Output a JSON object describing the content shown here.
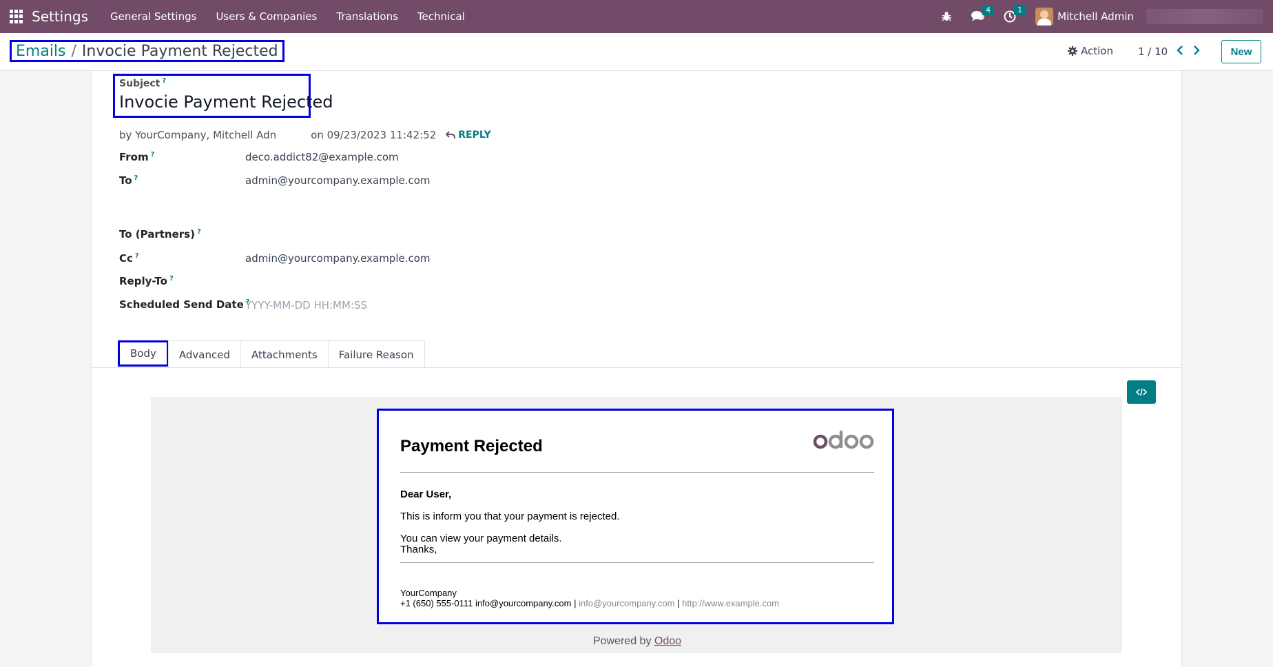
{
  "navbar": {
    "app_title": "Settings",
    "menu": [
      "General Settings",
      "Users & Companies",
      "Translations",
      "Technical"
    ],
    "messages_count": "4",
    "activities_count": "1",
    "user_name": "Mitchell Admin"
  },
  "control": {
    "breadcrumb_parent": "Emails",
    "breadcrumb_separator": "/",
    "breadcrumb_current": "Invocie Payment Rejected",
    "action_label": "Action",
    "pager": "1 / 10",
    "new_label": "New"
  },
  "form": {
    "subject_label": "Subject",
    "subject_value": "Invocie Payment Rejected",
    "help_mark": "?",
    "author": "by YourCompany, Mitchell Adn",
    "date": "on 09/23/2023 11:42:52",
    "reply_label": "REPLY",
    "fields": {
      "from_label": "From",
      "from_value": "deco.addict82@example.com",
      "to_label": "To",
      "to_value": "admin@yourcompany.example.com",
      "partners_label": "To (Partners)",
      "cc_label": "Cc",
      "cc_value": "admin@yourcompany.example.com",
      "reply_to_label": "Reply-To",
      "scheduled_label": "Scheduled Send Date",
      "scheduled_placeholder": "YYYY-MM-DD HH:MM:SS"
    },
    "tabs": [
      "Body",
      "Advanced",
      "Attachments",
      "Failure Reason"
    ]
  },
  "email": {
    "title": "Payment Rejected",
    "greeting": "Dear User,",
    "line1": "This is inform you that your payment is rejected.",
    "line2": "You can view your payment details.",
    "thanks": "Thanks,",
    "company": "YourCompany",
    "phone": "+1 (650) 555-0111",
    "email_plain": "info@yourcompany.com",
    "sep": "|",
    "email_link": "info@yourcompany.com",
    "website": "http://www.example.com",
    "powered_by": "Powered by",
    "powered_brand": "Odoo"
  },
  "colors": {
    "navbar": "#714b67",
    "accent": "#017e84",
    "highlight_box": "#0000e0"
  }
}
